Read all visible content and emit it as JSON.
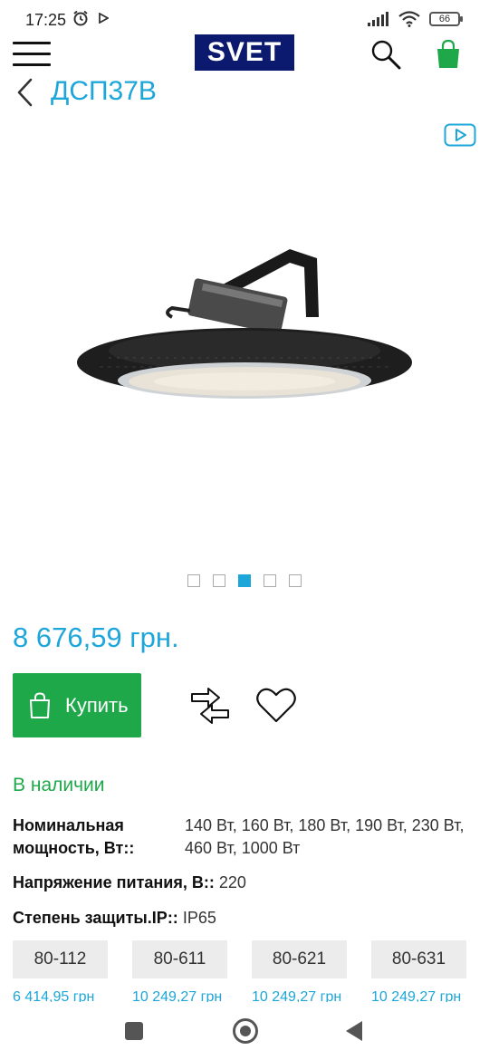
{
  "status_bar": {
    "time": "17:25",
    "battery": "66",
    "icons": [
      "alarm-icon",
      "play-icon",
      "signal-icon",
      "wifi-icon",
      "battery-icon"
    ]
  },
  "header": {
    "logo_text": "SVET",
    "icons": [
      "menu-icon",
      "search-icon",
      "cart-icon"
    ]
  },
  "product": {
    "title": "ДСП37В",
    "price": "8 676,59 грн.",
    "buy_label": "Купить",
    "stock_status": "В наличии",
    "gallery": {
      "total": 5,
      "active": 3
    }
  },
  "specs": [
    {
      "key": "Номинальная мощность, Вт::",
      "value": "140 Вт, 160 Вт, 180 Вт, 190 Вт, 230 Вт, 460 Вт, 1000 Вт"
    },
    {
      "key": "Напряжение питания, В::",
      "value": "220"
    },
    {
      "key": "Степень защиты.IP::",
      "value": "IP65"
    }
  ],
  "variants": [
    {
      "code": "80-112",
      "price": "6 414,95 грн"
    },
    {
      "code": "80-611",
      "price": "10 249,27 грн"
    },
    {
      "code": "80-621",
      "price": "10 249,27 грн"
    },
    {
      "code": "80-631",
      "price": "10 249,27 грн"
    }
  ],
  "colors": {
    "accent": "#1da6d9",
    "buy_green": "#1fa84a",
    "logo_bg": "#0b1a6e"
  }
}
